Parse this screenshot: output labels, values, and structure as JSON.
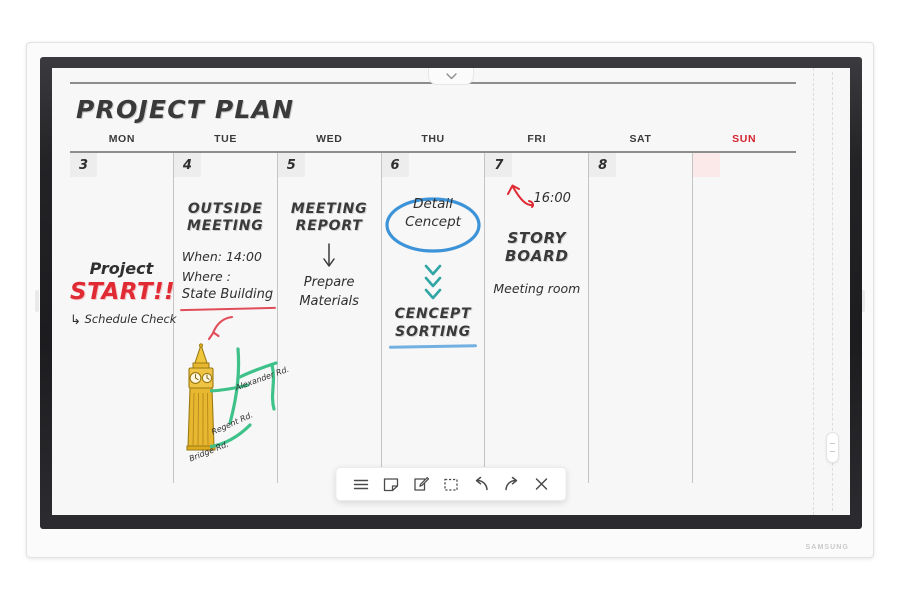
{
  "device": {
    "brand": "SAMSUNG",
    "pulldown_icon": "chevron-down-icon",
    "scrollbar_icon": "scroll-thumb-handle"
  },
  "board": {
    "title": "PROJECT PLAN",
    "weekdays": [
      {
        "label": "MON",
        "weekend": false
      },
      {
        "label": "TUE",
        "weekend": false
      },
      {
        "label": "WED",
        "weekend": false
      },
      {
        "label": "THU",
        "weekend": false
      },
      {
        "label": "FRI",
        "weekend": false
      },
      {
        "label": "SAT",
        "weekend": false
      },
      {
        "label": "SUN",
        "weekend": true
      }
    ],
    "dates": [
      "3",
      "4",
      "5",
      "6",
      "7",
      "8",
      ""
    ],
    "days": {
      "mon": {
        "line1": "Project",
        "line2": "START!!",
        "line3": "Schedule Check",
        "hook": "↳",
        "accent": "#e02b34"
      },
      "tue": {
        "title_line1": "OUTSIDE",
        "title_line2": "MEETING",
        "when": "When: 14:00",
        "where_label": "Where :",
        "where_value": "State Building",
        "underline_color": "#e04d58",
        "arrow_color": "#e04d58",
        "drawing": "big-ben-clock-tower",
        "tower_color": "#e8b730",
        "street_color": "#3fc28a",
        "street_labels": [
          "Alexander Rd.",
          "Regent Rd.",
          "Bridge Rd."
        ]
      },
      "wed": {
        "title_line1": "MEETING",
        "title_line2": "REPORT",
        "arrow": "down-arrow",
        "note_line1": "Prepare",
        "note_line2": "Materials"
      },
      "thu": {
        "oval_line1": "Detail",
        "oval_line2": "Cencept",
        "oval_color": "#3d93d8",
        "chevrons": "triple-chevron-down",
        "chevron_color": "#2fa5a5",
        "result_line1": "CENCEPT",
        "result_line2": "SORTING",
        "underline_color": "#5ba3dd"
      },
      "fri": {
        "arrow": "curved-arrow-up-left",
        "arrow_color": "#e02b34",
        "time": "16:00",
        "title_line1": "STORY",
        "title_line2": "BOARD",
        "room": "Meeting room"
      },
      "sat": {},
      "sun": {
        "highlight_color": "#fbe9ea"
      }
    }
  },
  "toolbar": {
    "buttons": [
      {
        "name": "menu-icon",
        "label": "Menu"
      },
      {
        "name": "note-icon",
        "label": "New note"
      },
      {
        "name": "pen-edit-icon",
        "label": "Pen"
      },
      {
        "name": "select-box-icon",
        "label": "Select"
      },
      {
        "name": "undo-icon",
        "label": "Undo"
      },
      {
        "name": "redo-icon",
        "label": "Redo"
      },
      {
        "name": "close-icon",
        "label": "Close"
      }
    ]
  }
}
